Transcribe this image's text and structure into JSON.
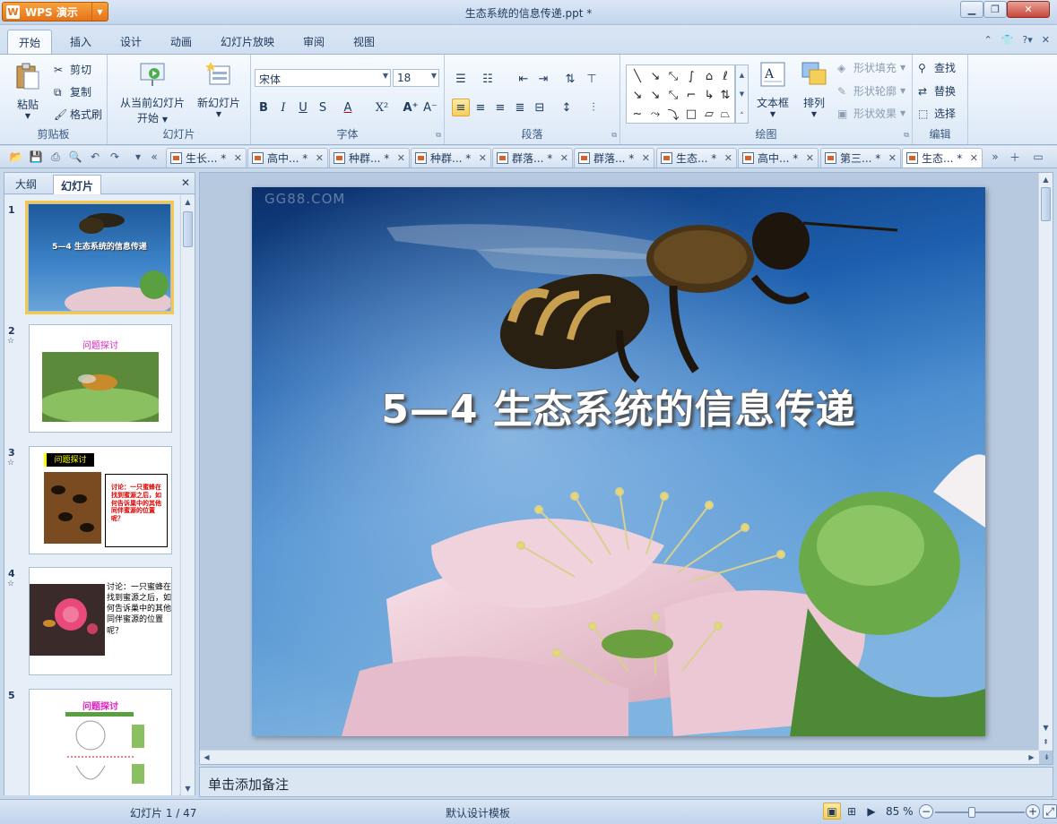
{
  "app": {
    "menu_label": "WPS 演示",
    "title": "生态系统的信息传递.ppt *"
  },
  "ribbon_tabs": [
    "开始",
    "插入",
    "设计",
    "动画",
    "幻灯片放映",
    "审阅",
    "视图"
  ],
  "clipboard": {
    "paste": "粘贴",
    "cut": "剪切",
    "copy": "复制",
    "format_painter": "格式刷",
    "label": "剪贴板"
  },
  "slides_group": {
    "from_current": "从当前幻灯片",
    "start": "开始",
    "new_slide": "新幻灯片",
    "label": "幻灯片"
  },
  "font": {
    "name": "宋体",
    "size": "18",
    "label": "字体"
  },
  "paragraph": {
    "label": "段落"
  },
  "drawing": {
    "textbox": "文本框",
    "arrange": "排列",
    "shape_fill": "形状填充",
    "shape_outline": "形状轮廓",
    "shape_effects": "形状效果",
    "label": "绘图"
  },
  "editing": {
    "find": "查找",
    "replace": "替换",
    "select": "选择",
    "label": "编辑"
  },
  "doc_tabs": [
    "生长... *",
    "高中... *",
    "种群... *",
    "种群... *",
    "群落... *",
    "群落... *",
    "生态... *",
    "高中... *",
    "第三... *",
    "生态... *"
  ],
  "panel": {
    "outline_tab": "大纲",
    "slides_tab": "幻灯片"
  },
  "thumbnails": {
    "t1": {
      "num": "1",
      "title": "5—4  生态系统的信息传递"
    },
    "t2": {
      "num": "2",
      "title": "问题探讨"
    },
    "t3": {
      "num": "3",
      "title": "问题探讨",
      "note": "讨论：一只蜜蜂在找到蜜源之后，如何告诉巢中的其他同伴蜜源的位置呢？"
    },
    "t4": {
      "num": "4",
      "note": "讨论：一只蜜蜂在找到蜜源之后，如何告诉巢中的其他同伴蜜源的位置呢？"
    },
    "t5": {
      "num": "5",
      "title": "问题探讨"
    }
  },
  "slide": {
    "watermark": "GG88.COM",
    "title": "5—4   生态系统的信息传递"
  },
  "notes_placeholder": "单击添加备注",
  "status": {
    "slide_pos": "幻灯片 1 / 47",
    "template": "默认设计模板",
    "zoom": "85 %"
  },
  "icons": {
    "close": "close-icon",
    "minimize": "minimize-icon",
    "maximize": "maximize-icon",
    "star": "star-icon",
    "help": "help-icon"
  },
  "colors": {
    "accent": "#e6731a",
    "ribbon_bg": "#dce8f6",
    "active_btn": "#f6cf5a",
    "thumb_title_magenta": "#e020c0"
  }
}
